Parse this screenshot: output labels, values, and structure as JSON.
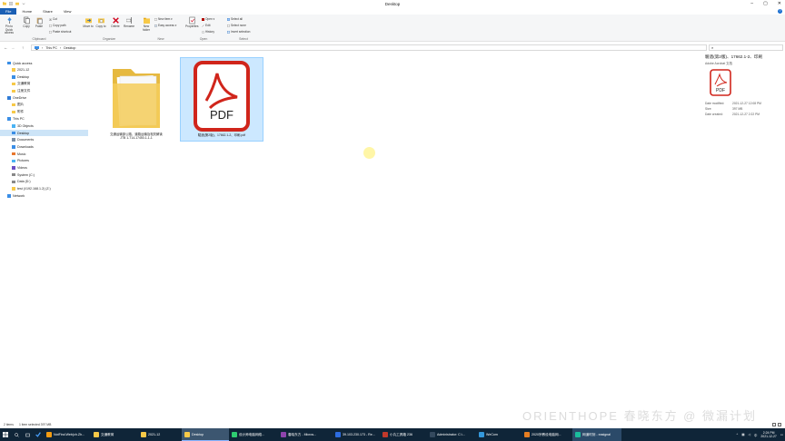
{
  "window": {
    "title": "Desktop",
    "min": "–",
    "max": "▢",
    "close": "✕"
  },
  "menu": {
    "tabs": [
      "File",
      "Home",
      "Share",
      "View"
    ],
    "help": "?"
  },
  "ribbon": {
    "clipboard": {
      "label": "Clipboard",
      "pin": "Pin to Quick access",
      "copy": "Copy",
      "paste": "Paste",
      "cut": "Cut",
      "copy_path": "Copy path",
      "paste_shortcut": "Paste shortcut"
    },
    "organize": {
      "label": "Organize",
      "move_to": "Move to",
      "copy_to": "Copy to",
      "delete": "Delete",
      "rename": "Rename"
    },
    "new": {
      "label": "New",
      "new_folder": "New folder",
      "new_item": "New item ▾",
      "easy_access": "Easy access ▾"
    },
    "open": {
      "label": "Open",
      "properties": "Properties",
      "open": "Open ▾",
      "edit": "Edit",
      "history": "History"
    },
    "select": {
      "label": "Select",
      "select_all": "Select all",
      "select_none": "Select none",
      "invert": "Invert selection"
    }
  },
  "address": {
    "back": "←",
    "forward": "→",
    "up": "↑",
    "crumbs": [
      "This PC",
      "Desktop"
    ],
    "search_placeholder": "Search Desktop"
  },
  "nav": {
    "items": [
      {
        "label": "Quick access",
        "level": 0
      },
      {
        "label": "2021-12",
        "level": 1
      },
      {
        "label": "Desktop",
        "level": 1
      },
      {
        "label": "交通教育",
        "level": 1
      },
      {
        "label": "注册文件",
        "level": 1
      },
      {
        "label": "OneDrive",
        "level": 0
      },
      {
        "label": "图片",
        "level": 1
      },
      {
        "label": "附件",
        "level": 1
      },
      {
        "label": "This PC",
        "level": 0
      },
      {
        "label": "3D Objects",
        "level": 1
      },
      {
        "label": "Desktop",
        "level": 1,
        "selected": true
      },
      {
        "label": "Documents",
        "level": 1
      },
      {
        "label": "Downloads",
        "level": 1
      },
      {
        "label": "Music",
        "level": 1
      },
      {
        "label": "Pictures",
        "level": 1
      },
      {
        "label": "Videos",
        "level": 1
      },
      {
        "label": "System (C:)",
        "level": 1
      },
      {
        "label": "Data (D:)",
        "level": 1
      },
      {
        "label": "test (\\\\192.168.1.2) (Z:)",
        "level": 1
      },
      {
        "label": "Network",
        "level": 0
      }
    ]
  },
  "files": [
    {
      "name_line1": "交通运输部公路、道路运输及相关解读",
      "name_line2": "JTB 1-T14-17450-1-1-1",
      "type": "folder"
    },
    {
      "name_line1": "驗酒(第2版)、17662.1-2、印刷.pdf",
      "type": "pdf",
      "selected": true,
      "icon_text": "PDF"
    }
  ],
  "detail": {
    "title": "驗酒(第2版)、17662.1-2、印刷",
    "subtitle": "Adobe Acrobat 文档",
    "icon_text": "PDF",
    "rows": [
      {
        "k": "Date modified:",
        "v": "2021-12-27 12:08 PM"
      },
      {
        "k": "Size:",
        "v": "397 MB"
      },
      {
        "k": "Date created:",
        "v": "2021-12-27 2:22 PM"
      }
    ]
  },
  "status": {
    "count": "2 items",
    "selected": "1 item selected  397 MB"
  },
  "watermark": "ORIENTHOPE 春晓东方 @ 微漏计划",
  "taskbar": {
    "items": [
      {
        "label": "NotFind.Web(ch.Zh...",
        "color": "#f39c12"
      },
      {
        "label": "交通教育",
        "color": "#f7c948"
      },
      {
        "label": "2021-12",
        "color": "#f7c948"
      },
      {
        "label": "Desktop",
        "color": "#f7c948",
        "active": true
      },
      {
        "label": "设计师电脑网络...",
        "color": "#2ecc71"
      },
      {
        "label": "春晓东方 - Micros...",
        "color": "#8e44ad"
      },
      {
        "label": "39.103.230.173 - Re...",
        "color": "#2d6cdf"
      },
      {
        "label": "小丸工具箱 236",
        "color": "#c0392b"
      },
      {
        "label": "Administrator: C:\\...",
        "color": "#34495e"
      },
      {
        "label": "WeCom",
        "color": "#3498db"
      },
      {
        "label": "2020宗教设电脑网...",
        "color": "#e67e22"
      },
      {
        "label": "网道时刻 - easignal",
        "color": "#1abc9c",
        "hl": true
      }
    ],
    "time": "2:24 PM",
    "date": "2021-12-27",
    "lang": "中"
  }
}
